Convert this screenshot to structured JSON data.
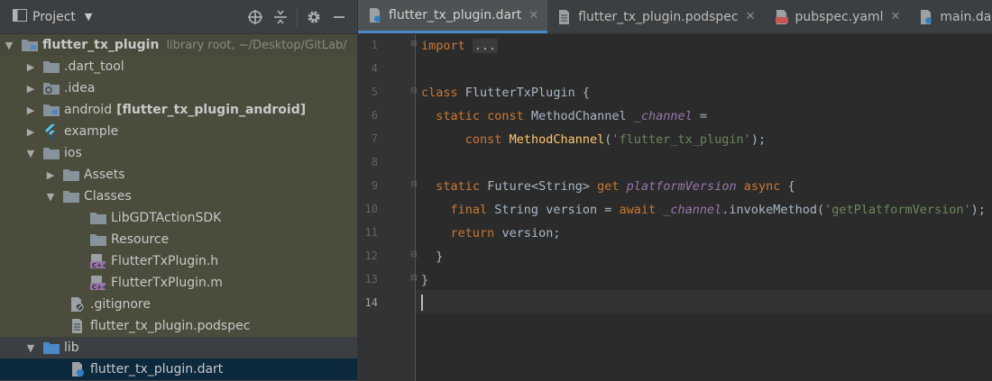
{
  "project_panel": {
    "title": "Project",
    "tools": [
      "target-icon",
      "collapse-icon",
      "gear-icon",
      "minimize-icon"
    ]
  },
  "tree": [
    {
      "label": "flutter_tx_plugin",
      "sub": "library root, ~/Desktop/GitLab/",
      "icon": "folder-module",
      "arrow": "down",
      "depth": 0,
      "bold": true
    },
    {
      "label": ".dart_tool",
      "icon": "folder",
      "arrow": "right",
      "depth": 1
    },
    {
      "label": ".idea",
      "icon": "folder-config",
      "arrow": "right",
      "depth": 1
    },
    {
      "label": "android",
      "mod": "[flutter_tx_plugin_android]",
      "icon": "folder-module",
      "arrow": "right",
      "depth": 1
    },
    {
      "label": "example",
      "icon": "flutter",
      "arrow": "right",
      "depth": 1
    },
    {
      "label": "ios",
      "icon": "folder",
      "arrow": "down",
      "depth": 1
    },
    {
      "label": "Assets",
      "icon": "folder",
      "arrow": "right",
      "depth": 2
    },
    {
      "label": "Classes",
      "icon": "folder",
      "arrow": "down",
      "depth": 2
    },
    {
      "label": "LibGDTActionSDK",
      "icon": "folder",
      "arrow": "",
      "depth": 3
    },
    {
      "label": "Resource",
      "icon": "folder",
      "arrow": "",
      "depth": 3
    },
    {
      "label": "FlutterTxPlugin.h",
      "icon": "cpp-file",
      "arrow": "",
      "depth": 3
    },
    {
      "label": "FlutterTxPlugin.m",
      "icon": "cpp-file",
      "arrow": "",
      "depth": 3
    },
    {
      "label": ".gitignore",
      "icon": "ignore-file",
      "arrow": "",
      "depth": 2
    },
    {
      "label": "flutter_tx_plugin.podspec",
      "icon": "text-file",
      "arrow": "",
      "depth": 2
    },
    {
      "label": "lib",
      "icon": "folder-source",
      "arrow": "down",
      "depth": 1
    },
    {
      "label": "flutter_tx_plugin.dart",
      "icon": "dart-file",
      "arrow": "",
      "depth": 2
    }
  ],
  "tabs": [
    {
      "label": "flutter_tx_plugin.dart",
      "icon": "dart-file",
      "active": true
    },
    {
      "label": "flutter_tx_plugin.podspec",
      "icon": "text-file",
      "active": false
    },
    {
      "label": "pubspec.yaml",
      "icon": "yaml-file",
      "active": false
    },
    {
      "label": "main.dart",
      "icon": "dart-file",
      "active": false
    }
  ],
  "editor": {
    "line_numbers": [
      "1",
      "4",
      "5",
      "6",
      "7",
      "8",
      "9",
      "10",
      "11",
      "12",
      "13",
      "14"
    ],
    "current_line": "14",
    "tokens": {
      "import": "import",
      "fold_placeholder": "...",
      "class_kw": "class",
      "class_name": "FlutterTxPlugin",
      "brace_open": " {",
      "static_const": "static const",
      "method_channel_type": "MethodChannel",
      "channel_field": "_channel",
      "assign": " =",
      "const_kw": "const",
      "method_channel_ctor": "MethodChannel",
      "paren_open": "(",
      "channel_name": "'flutter_tx_plugin'",
      "paren_close_semi": ");",
      "static_kw": "static",
      "future_type": "Future<String>",
      "get_kw": "get",
      "platform_version": "platformVersion",
      "async_kw": "async",
      "final_kw": "final",
      "string_type": "String version =",
      "await_kw": "await",
      "invoke": ".invokeMethod(",
      "get_platform_version_str": "'getPlatformVersion'",
      "return_kw": "return",
      "version_semi": "version;",
      "close_brace": "}"
    }
  }
}
